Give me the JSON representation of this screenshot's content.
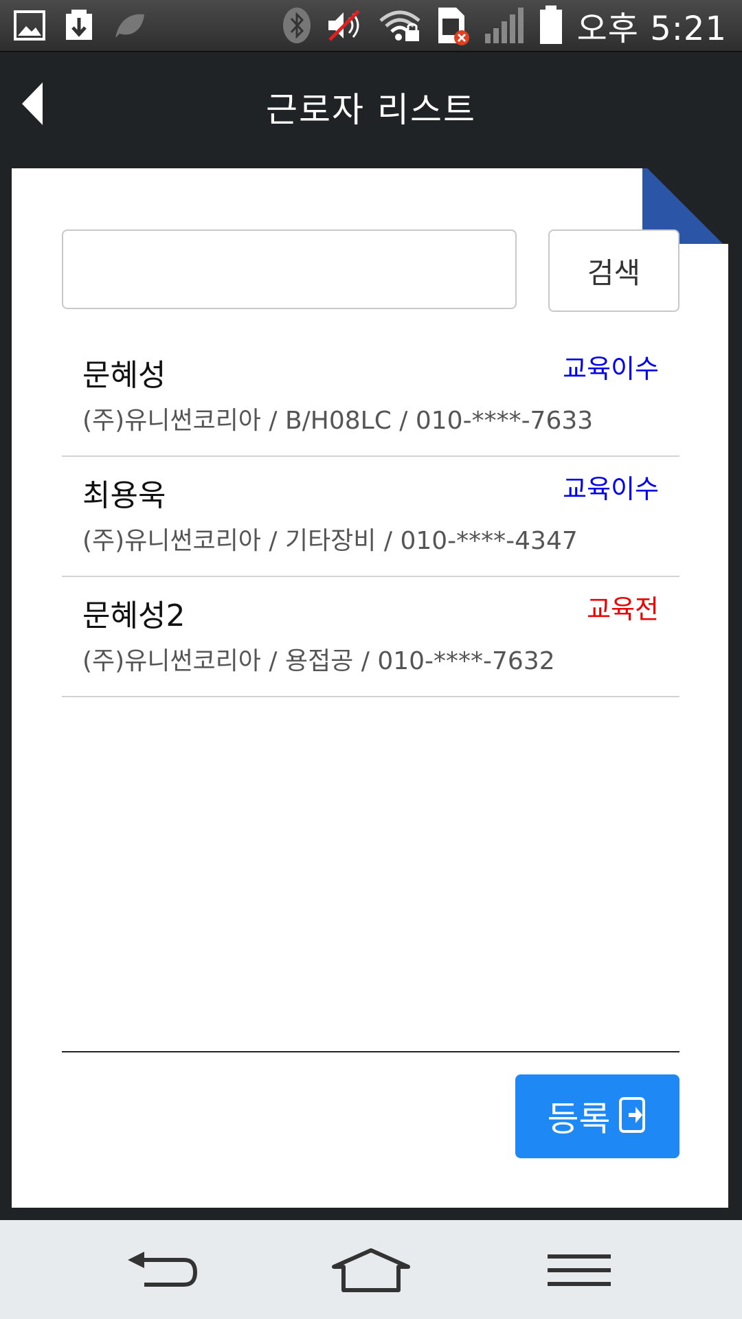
{
  "status_bar": {
    "time": "오후 5:21",
    "icons": [
      "image-icon",
      "download-icon",
      "leaf-icon",
      "bluetooth-icon",
      "mute-icon",
      "wifi-lock-icon",
      "sim-error-icon",
      "signal-icon",
      "battery-icon"
    ]
  },
  "app_bar": {
    "title": "근로자 리스트",
    "back_icon": "back-arrow-icon"
  },
  "search": {
    "placeholder": "",
    "value": "",
    "button_label": "검색"
  },
  "workers": [
    {
      "name": "문혜성",
      "status": "교육이수",
      "status_color": "#0000ee",
      "detail": "(주)유니썬코리아 / B/H08LC / 010-****-7633"
    },
    {
      "name": "최용욱",
      "status": "교육이수",
      "status_color": "#0000ee",
      "detail": "(주)유니썬코리아 / 기타장비 / 010-****-4347"
    },
    {
      "name": "문혜성2",
      "status": "교육전",
      "status_color": "#ee0000",
      "detail": "(주)유니썬코리아 / 용접공 / 010-****-7632"
    }
  ],
  "register_button": {
    "label": "등록",
    "icon": "enter-door-icon",
    "color": "#1e88f5"
  },
  "nav_bar": {
    "icons": [
      "nav-back-icon",
      "nav-home-icon",
      "nav-menu-icon"
    ]
  },
  "colors": {
    "header_bg": "#1f2326",
    "accent_fold": "#2b55a6"
  }
}
